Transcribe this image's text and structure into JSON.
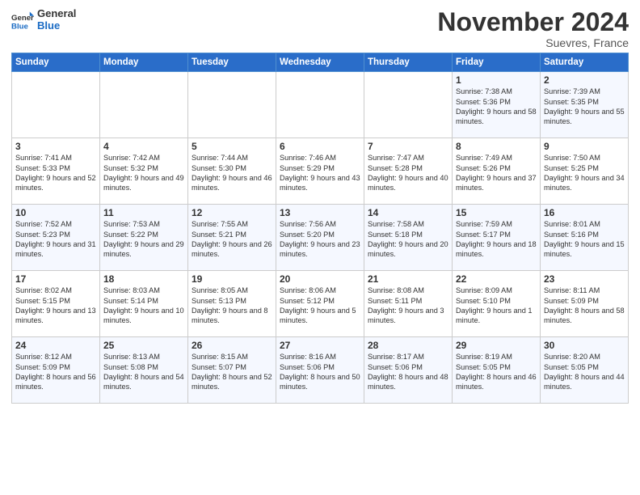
{
  "logo": {
    "line1": "General",
    "line2": "Blue"
  },
  "title": "November 2024",
  "location": "Suevres, France",
  "weekdays": [
    "Sunday",
    "Monday",
    "Tuesday",
    "Wednesday",
    "Thursday",
    "Friday",
    "Saturday"
  ],
  "weeks": [
    [
      {
        "day": "",
        "text": ""
      },
      {
        "day": "",
        "text": ""
      },
      {
        "day": "",
        "text": ""
      },
      {
        "day": "",
        "text": ""
      },
      {
        "day": "",
        "text": ""
      },
      {
        "day": "1",
        "text": "Sunrise: 7:38 AM\nSunset: 5:36 PM\nDaylight: 9 hours and 58 minutes."
      },
      {
        "day": "2",
        "text": "Sunrise: 7:39 AM\nSunset: 5:35 PM\nDaylight: 9 hours and 55 minutes."
      }
    ],
    [
      {
        "day": "3",
        "text": "Sunrise: 7:41 AM\nSunset: 5:33 PM\nDaylight: 9 hours and 52 minutes."
      },
      {
        "day": "4",
        "text": "Sunrise: 7:42 AM\nSunset: 5:32 PM\nDaylight: 9 hours and 49 minutes."
      },
      {
        "day": "5",
        "text": "Sunrise: 7:44 AM\nSunset: 5:30 PM\nDaylight: 9 hours and 46 minutes."
      },
      {
        "day": "6",
        "text": "Sunrise: 7:46 AM\nSunset: 5:29 PM\nDaylight: 9 hours and 43 minutes."
      },
      {
        "day": "7",
        "text": "Sunrise: 7:47 AM\nSunset: 5:28 PM\nDaylight: 9 hours and 40 minutes."
      },
      {
        "day": "8",
        "text": "Sunrise: 7:49 AM\nSunset: 5:26 PM\nDaylight: 9 hours and 37 minutes."
      },
      {
        "day": "9",
        "text": "Sunrise: 7:50 AM\nSunset: 5:25 PM\nDaylight: 9 hours and 34 minutes."
      }
    ],
    [
      {
        "day": "10",
        "text": "Sunrise: 7:52 AM\nSunset: 5:23 PM\nDaylight: 9 hours and 31 minutes."
      },
      {
        "day": "11",
        "text": "Sunrise: 7:53 AM\nSunset: 5:22 PM\nDaylight: 9 hours and 29 minutes."
      },
      {
        "day": "12",
        "text": "Sunrise: 7:55 AM\nSunset: 5:21 PM\nDaylight: 9 hours and 26 minutes."
      },
      {
        "day": "13",
        "text": "Sunrise: 7:56 AM\nSunset: 5:20 PM\nDaylight: 9 hours and 23 minutes."
      },
      {
        "day": "14",
        "text": "Sunrise: 7:58 AM\nSunset: 5:18 PM\nDaylight: 9 hours and 20 minutes."
      },
      {
        "day": "15",
        "text": "Sunrise: 7:59 AM\nSunset: 5:17 PM\nDaylight: 9 hours and 18 minutes."
      },
      {
        "day": "16",
        "text": "Sunrise: 8:01 AM\nSunset: 5:16 PM\nDaylight: 9 hours and 15 minutes."
      }
    ],
    [
      {
        "day": "17",
        "text": "Sunrise: 8:02 AM\nSunset: 5:15 PM\nDaylight: 9 hours and 13 minutes."
      },
      {
        "day": "18",
        "text": "Sunrise: 8:03 AM\nSunset: 5:14 PM\nDaylight: 9 hours and 10 minutes."
      },
      {
        "day": "19",
        "text": "Sunrise: 8:05 AM\nSunset: 5:13 PM\nDaylight: 9 hours and 8 minutes."
      },
      {
        "day": "20",
        "text": "Sunrise: 8:06 AM\nSunset: 5:12 PM\nDaylight: 9 hours and 5 minutes."
      },
      {
        "day": "21",
        "text": "Sunrise: 8:08 AM\nSunset: 5:11 PM\nDaylight: 9 hours and 3 minutes."
      },
      {
        "day": "22",
        "text": "Sunrise: 8:09 AM\nSunset: 5:10 PM\nDaylight: 9 hours and 1 minute."
      },
      {
        "day": "23",
        "text": "Sunrise: 8:11 AM\nSunset: 5:09 PM\nDaylight: 8 hours and 58 minutes."
      }
    ],
    [
      {
        "day": "24",
        "text": "Sunrise: 8:12 AM\nSunset: 5:09 PM\nDaylight: 8 hours and 56 minutes."
      },
      {
        "day": "25",
        "text": "Sunrise: 8:13 AM\nSunset: 5:08 PM\nDaylight: 8 hours and 54 minutes."
      },
      {
        "day": "26",
        "text": "Sunrise: 8:15 AM\nSunset: 5:07 PM\nDaylight: 8 hours and 52 minutes."
      },
      {
        "day": "27",
        "text": "Sunrise: 8:16 AM\nSunset: 5:06 PM\nDaylight: 8 hours and 50 minutes."
      },
      {
        "day": "28",
        "text": "Sunrise: 8:17 AM\nSunset: 5:06 PM\nDaylight: 8 hours and 48 minutes."
      },
      {
        "day": "29",
        "text": "Sunrise: 8:19 AM\nSunset: 5:05 PM\nDaylight: 8 hours and 46 minutes."
      },
      {
        "day": "30",
        "text": "Sunrise: 8:20 AM\nSunset: 5:05 PM\nDaylight: 8 hours and 44 minutes."
      }
    ]
  ]
}
